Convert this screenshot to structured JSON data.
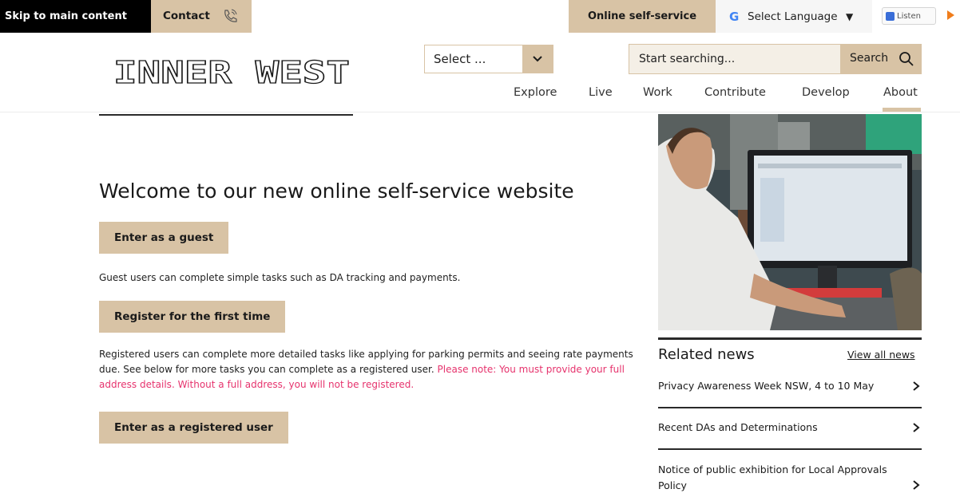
{
  "topbar": {
    "skip_label": "Skip to main content",
    "contact_label": "Contact",
    "self_service_label": "Online self-service",
    "language_label": "Select Language",
    "language_arrow": "▼",
    "listen_label": "Listen"
  },
  "header": {
    "logo_text": "INNER WEST",
    "select_value": "Select ...",
    "search_placeholder": "Start searching...",
    "search_button": "Search",
    "nav": [
      "Explore",
      "Live",
      "Work",
      "Contribute",
      "Develop",
      "About"
    ],
    "active_nav": "About"
  },
  "main": {
    "title": "Welcome to our new online self-service website",
    "guest_button": "Enter as a guest",
    "guest_text": "Guest users can complete simple tasks such as DA tracking and payments.",
    "register_button": "Register for the first time",
    "registered_text": "Registered users can complete more detailed tasks like applying for parking permits and seeing rate payments due. See below for more tasks you can complete as a registered user.",
    "warning_text": "Please note: You must provide your full address details. Without a full address, you will not be registered.",
    "registered_button": "Enter as a registered user"
  },
  "related": {
    "title": "Related news",
    "view_all": "View all news",
    "items": [
      "Privacy Awareness Week NSW, 4 to 10 May",
      "Recent DAs and Determinations",
      "Notice of public exhibition for Local Approvals Policy"
    ]
  },
  "colors": {
    "accent": "#d8c3a5",
    "warning": "#e6336d"
  }
}
